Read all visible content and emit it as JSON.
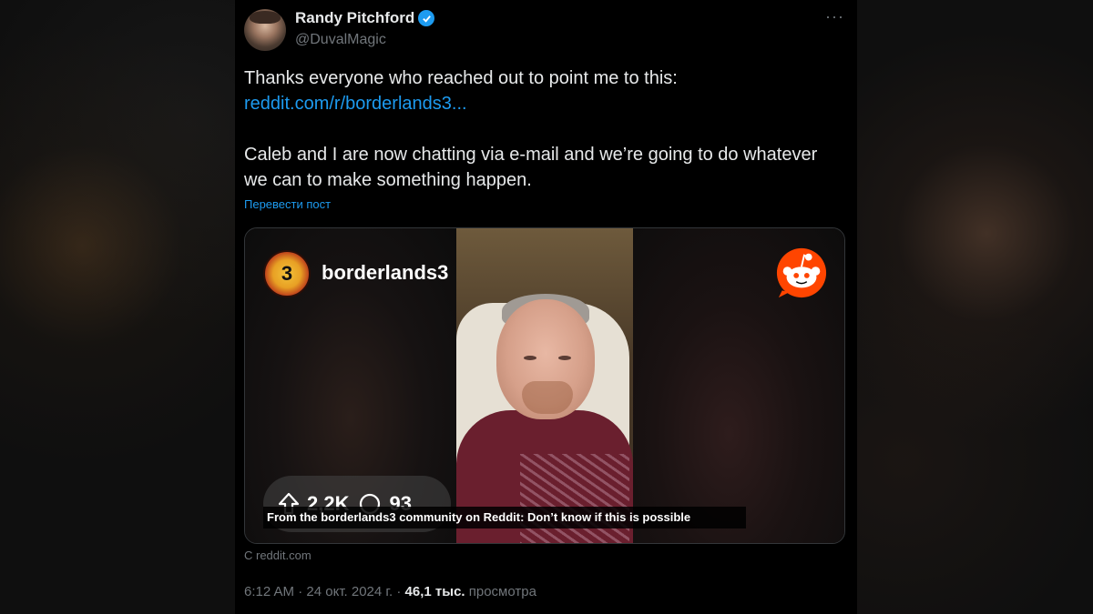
{
  "author": {
    "name": "Randy Pitchford",
    "handle": "@DuvalMagic"
  },
  "tweet": {
    "line1": "Thanks everyone who reached out to point me to this:",
    "link": "reddit.com/r/borderlands3...",
    "line2": "Caleb and I are now chatting via e-mail and we’re going to do whatever we can to make something happen.",
    "translate": "Перевести пост"
  },
  "card": {
    "subreddit": "borderlands3",
    "subreddit_logo_text": "3",
    "upvotes": "2,2K",
    "comments": "93",
    "caption": "From the borderlands3 community on Reddit: Don’t know if this is possible",
    "source": "С reddit.com"
  },
  "meta": {
    "time": "6:12 AM",
    "date": "24 окт. 2024 г.",
    "views_count": "46,1 тыс.",
    "views_label": "просмотра",
    "sep": "·"
  },
  "colors": {
    "link": "#1d9bf0",
    "reddit": "#ff4500"
  }
}
